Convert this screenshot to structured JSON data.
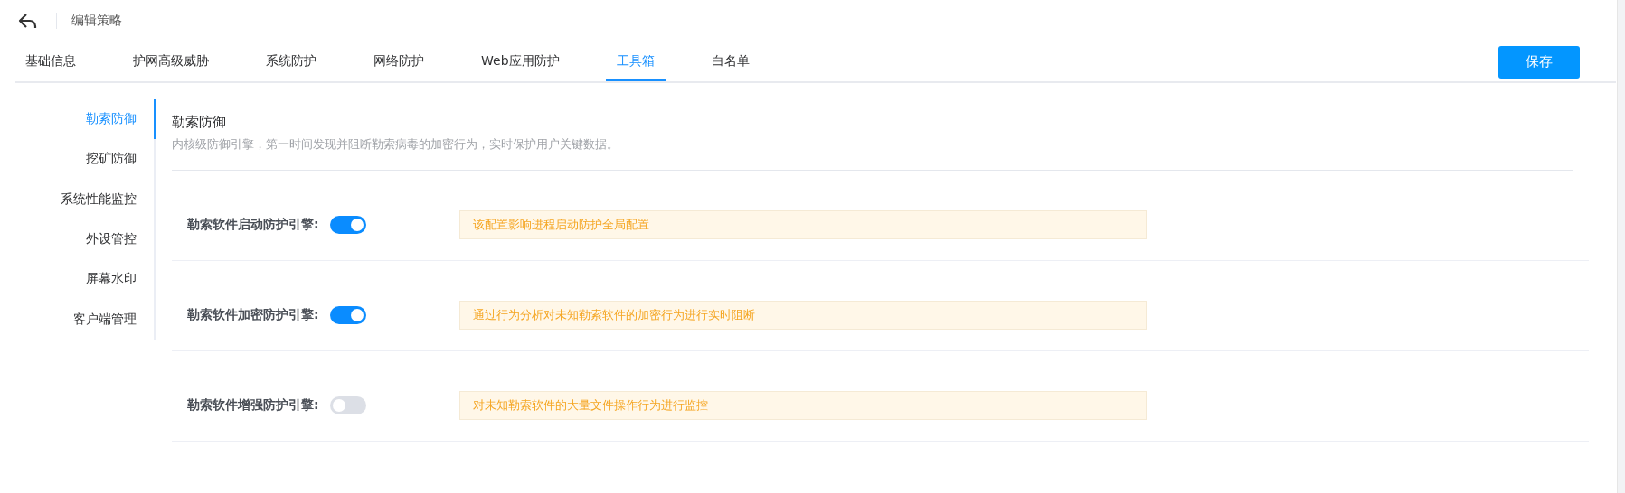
{
  "header": {
    "title": "编辑策略"
  },
  "tabs": [
    {
      "label": "基础信息",
      "selected": false
    },
    {
      "label": "护网高级威胁",
      "selected": false
    },
    {
      "label": "系统防护",
      "selected": false
    },
    {
      "label": "网络防护",
      "selected": false
    },
    {
      "label": "Web应用防护",
      "selected": false
    },
    {
      "label": "工具箱",
      "selected": true
    },
    {
      "label": "白名单",
      "selected": false
    }
  ],
  "save_button": "保存",
  "sidebar": {
    "items": [
      {
        "label": "勒索防御",
        "selected": true
      },
      {
        "label": "挖矿防御",
        "selected": false
      },
      {
        "label": "系统性能监控",
        "selected": false
      },
      {
        "label": "外设管控",
        "selected": false
      },
      {
        "label": "屏幕水印",
        "selected": false
      },
      {
        "label": "客户端管理",
        "selected": false
      }
    ]
  },
  "section": {
    "title": "勒索防御",
    "description": "内核级防御引擎，第一时间发现并阻断勒索病毒的加密行为，实时保护用户关键数据。"
  },
  "settings": [
    {
      "label": "勒索软件启动防护引擎:",
      "on": true,
      "hint": "该配置影响进程启动防护全局配置"
    },
    {
      "label": "勒索软件加密防护引擎:",
      "on": true,
      "hint": "通过行为分析对未知勒索软件的加密行为进行实时阻断"
    },
    {
      "label": "勒索软件增强防护引擎:",
      "on": false,
      "hint": "对未知勒索软件的大量文件操作行为进行监控"
    }
  ]
}
